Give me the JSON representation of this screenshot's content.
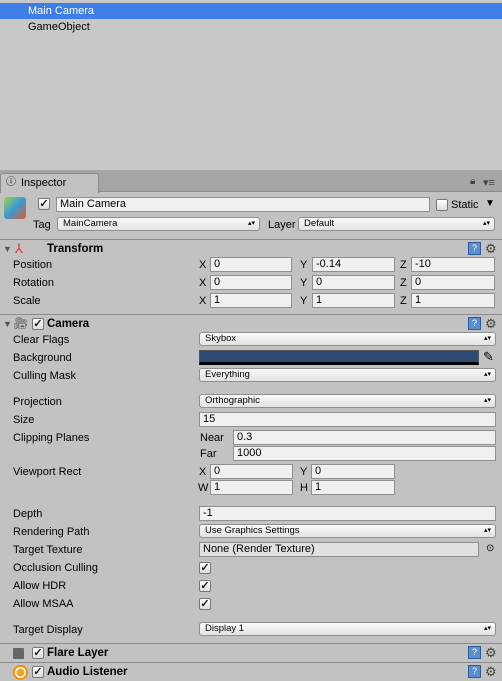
{
  "hierarchy": {
    "items": [
      {
        "label": "Main Camera",
        "selected": true
      },
      {
        "label": "GameObject"
      }
    ]
  },
  "inspector": {
    "tab": "Inspector",
    "object": {
      "name": "Main Camera",
      "active": true,
      "static_label": "Static",
      "static": false,
      "tag_label": "Tag",
      "tag": "MainCamera",
      "layer_label": "Layer",
      "layer": "Default"
    },
    "transform": {
      "title": "Transform",
      "position": {
        "label": "Position",
        "x": "0",
        "y": "-0.14",
        "z": "-10"
      },
      "rotation": {
        "label": "Rotation",
        "x": "0",
        "y": "0",
        "z": "0"
      },
      "scale": {
        "label": "Scale",
        "x": "1",
        "y": "1",
        "z": "1"
      },
      "axis": {
        "x": "X",
        "y": "Y",
        "z": "Z"
      }
    },
    "camera": {
      "title": "Camera",
      "enabled": true,
      "clear_flags": {
        "label": "Clear Flags",
        "value": "Skybox"
      },
      "background": {
        "label": "Background",
        "color": "#2e4a75"
      },
      "culling_mask": {
        "label": "Culling Mask",
        "value": "Everything"
      },
      "projection": {
        "label": "Projection",
        "value": "Orthographic"
      },
      "size": {
        "label": "Size",
        "value": "15"
      },
      "clipping": {
        "label": "Clipping Planes",
        "near_label": "Near",
        "near": "0.3",
        "far_label": "Far",
        "far": "1000"
      },
      "viewport": {
        "label": "Viewport Rect",
        "x_label": "X",
        "x": "0",
        "y_label": "Y",
        "y": "0",
        "w_label": "W",
        "w": "1",
        "h_label": "H",
        "h": "1"
      },
      "depth": {
        "label": "Depth",
        "value": "-1"
      },
      "rendering_path": {
        "label": "Rendering Path",
        "value": "Use Graphics Settings"
      },
      "target_texture": {
        "label": "Target Texture",
        "value": "None (Render Texture)"
      },
      "occlusion_culling": {
        "label": "Occlusion Culling",
        "checked": true
      },
      "allow_hdr": {
        "label": "Allow HDR",
        "checked": true
      },
      "allow_msaa": {
        "label": "Allow MSAA",
        "checked": true
      },
      "target_display": {
        "label": "Target Display",
        "value": "Display 1"
      }
    },
    "flare_layer": {
      "title": "Flare Layer",
      "enabled": true
    },
    "audio_listener": {
      "title": "Audio Listener",
      "enabled": true
    }
  }
}
